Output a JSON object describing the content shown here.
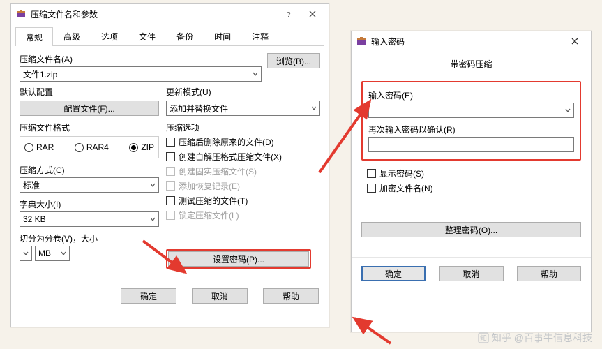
{
  "window1": {
    "title": "压缩文件名和参数",
    "tabs": [
      "常规",
      "高级",
      "选项",
      "文件",
      "备份",
      "时间",
      "注释"
    ],
    "active_tab": 0,
    "archive_name_label": "压缩文件名(A)",
    "archive_name_value": "文件1.zip",
    "browse_label": "浏览(B)...",
    "default_profile_label": "默认配置",
    "profiles_button": "配置文件(F)...",
    "update_mode_label": "更新模式(U)",
    "update_mode_value": "添加并替换文件",
    "format_label": "压缩文件格式",
    "formats": [
      "RAR",
      "RAR4",
      "ZIP"
    ],
    "selected_format": "ZIP",
    "options_label": "压缩选项",
    "options": [
      {
        "label": "压缩后删除原来的文件(D)",
        "enabled": true,
        "checked": false
      },
      {
        "label": "创建自解压格式压缩文件(X)",
        "enabled": true,
        "checked": false
      },
      {
        "label": "创建固实压缩文件(S)",
        "enabled": false,
        "checked": false
      },
      {
        "label": "添加恢复记录(E)",
        "enabled": false,
        "checked": false
      },
      {
        "label": "测试压缩的文件(T)",
        "enabled": true,
        "checked": false
      },
      {
        "label": "锁定压缩文件(L)",
        "enabled": false,
        "checked": false
      }
    ],
    "method_label": "压缩方式(C)",
    "method_value": "标准",
    "dict_label": "字典大小(I)",
    "dict_value": "32 KB",
    "volume_label": "切分为分卷(V)，大小",
    "volume_value": "",
    "volume_unit": "MB",
    "set_password_label": "设置密码(P)...",
    "ok": "确定",
    "cancel": "取消",
    "help": "帮助"
  },
  "window2": {
    "title": "输入密码",
    "subtitle": "带密码压缩",
    "enter_label": "输入密码(E)",
    "enter_value": "",
    "reenter_label": "再次输入密码以确认(R)",
    "reenter_value": "",
    "show_password_label": "显示密码(S)",
    "encrypt_names_label": "加密文件名(N)",
    "organize_label": "整理密码(O)...",
    "ok": "确定",
    "cancel": "取消",
    "help": "帮助"
  },
  "watermark": "知乎 @百事牛信息科技"
}
